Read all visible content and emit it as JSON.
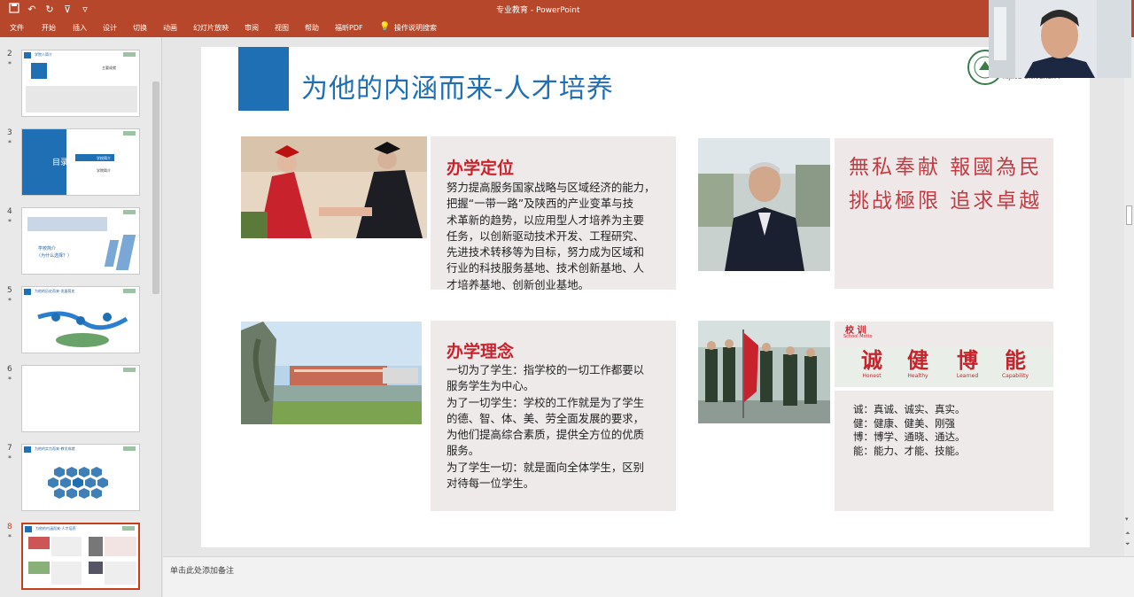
{
  "app": {
    "title": "专业教育 - PowerPoint",
    "quick_access": [
      "save-icon",
      "undo-icon",
      "redo-icon",
      "presenter-icon",
      "customize-icon"
    ]
  },
  "ribbon": {
    "tabs": [
      "文件",
      "开始",
      "插入",
      "设计",
      "切换",
      "动画",
      "幻灯片放映",
      "审阅",
      "视图",
      "帮助",
      "福昕PDF"
    ],
    "tell_me": "操作说明搜索"
  },
  "thumbnails": [
    {
      "num": "2",
      "mark": "*",
      "title": "学院人简介",
      "sub": "主要成就",
      "kind": "intro"
    },
    {
      "num": "3",
      "mark": "*",
      "title": "目录",
      "sub": "CONTENTS",
      "items": [
        "学校简介",
        "学院简介"
      ],
      "kind": "toc"
    },
    {
      "num": "4",
      "mark": "*",
      "title": "学校简介",
      "sub": "（为什么选择？）",
      "kind": "school"
    },
    {
      "num": "5",
      "mark": "*",
      "title": "为他的历史而来-发展简史",
      "kind": "timeline"
    },
    {
      "num": "6",
      "mark": "*",
      "title": "",
      "kind": "blank"
    },
    {
      "num": "7",
      "mark": "*",
      "title": "为他的实力而来-教学成就",
      "kind": "hex"
    },
    {
      "num": "8",
      "mark": "*",
      "title": "为他的内涵而来-人才培养",
      "kind": "current"
    }
  ],
  "slide": {
    "title": "为他的内涵而来-人才培养",
    "logo_text": "XIJING UNIVERSITY",
    "positioning": {
      "heading": "办学定位",
      "lines": [
        "努力提高服务国家战略与区域经济的能力，",
        "把握“一带一路”及陕西的产业变革与技",
        "术革新的趋势，以应用型人才培养为主要",
        "任务，以创新驱动技术开发、工程研究、",
        "先进技术转移等为目标，努力成为区域和",
        "行业的科技服务基地、技术创新基地、人",
        "才培养基地、创新创业基地。"
      ]
    },
    "philosophy": {
      "heading": "办学理念",
      "lines": [
        "一切为了学生：指学校的一切工作都要以",
        "服务学生为中心。",
        "为了一切学生：学校的工作就是为了学生",
        "的德、智、体、美、劳全面发展的要求，",
        "为他们提高综合素质，提供全方位的优质",
        "服务。",
        "为了学生一切：就是面向全体学生，区别",
        "对待每一位学生。"
      ]
    },
    "calligraphy": [
      "無私奉献 報國為民",
      "挑战極限 追求卓越"
    ],
    "motto": {
      "label_cn": "校 训",
      "label_en": "School Motto",
      "chars": [
        {
          "cn": "诚",
          "en": "Honest"
        },
        {
          "cn": "健",
          "en": "Healthy"
        },
        {
          "cn": "博",
          "en": "Learned"
        },
        {
          "cn": "能",
          "en": "Capability"
        }
      ],
      "lines": [
        "诚：真诚、诚实、真实。",
        "健：健康、健美、刚强",
        "博：博学、通晓、通达。",
        "能：能力、才能、技能。"
      ]
    }
  },
  "notes_placeholder": "单击此处添加备注",
  "colors": {
    "ribbon": "#b7472a",
    "accent_blue": "#1f6fb5",
    "heading_red": "#c8232c",
    "panel_bg": "#efeaea"
  }
}
